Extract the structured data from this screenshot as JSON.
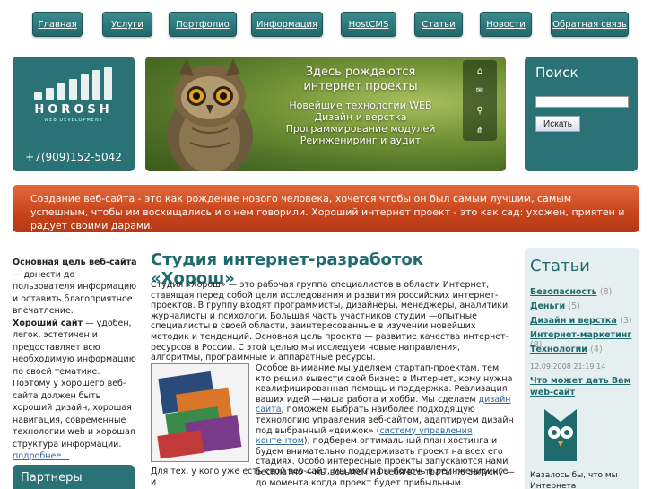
{
  "nav": {
    "items": [
      {
        "label": "Главная"
      },
      {
        "label": "Услуги"
      },
      {
        "label": "Портфолио"
      },
      {
        "label": "Информация"
      },
      {
        "label": "HostCMS"
      },
      {
        "label": "Статьи"
      },
      {
        "label": "Новости"
      },
      {
        "label": "Обратная связь"
      }
    ]
  },
  "logo": {
    "name": "HOROSH",
    "tagline": "WEB DEVELOPMENT",
    "phone": "+7(909)152-5042"
  },
  "hero": {
    "title_line1": "Здесь рождаются",
    "title_line2": "интернет проекты",
    "lines": [
      "Новейшие технологии WEB",
      "Дизайн и верстка",
      "Программирование модулей",
      "Реинжениринг и аудит"
    ],
    "icons": [
      "home-icon",
      "mail-icon",
      "search-icon",
      "sitemap-icon"
    ]
  },
  "search": {
    "title": "Поиск",
    "placeholder": "",
    "button_label": "Искать"
  },
  "banner": {
    "text": "Создание веб-сайта - это как рождение нового человека, хочется чтобы он был самым лучшим, самым успешным, чтобы им восхищались и о нем говорили. Хороший интернет проект - это как сад: ухожен, приятен и радует своими дарами."
  },
  "left": {
    "bold1": "Основная цель веб-сайта",
    "text1": " — донести до пользователя информацию и оставить благоприятное впечатление.",
    "bold2": "Хороший сайт",
    "text2": " — удобен, легок, эстетичен и предоставляет всю необходимую информацию по своей тематике. Поэтому у хорошего веб-сайта должен быть хороший дизайн, хорошая навигация, современные технологии web и хорошая структура информации.",
    "more": "подробнее...",
    "partners_title": "Партнеры"
  },
  "main": {
    "title": "Студия интернет-разработок «Хорош»",
    "p1": "Студия «Хорош» — это рабочая группа специалистов в области Интернет, ставящая перед собой цели исследования и развития российских интернет-проектов. В группу входят программисты, дизайнеры, менеджеры, аналитики, журналисты и психологи. Большая часть участников студии —опытные специалисты в своей области, заинтересованные в изучении новейших методик и тенденций. Основная цель проекта — развитие качества интернет-ресурсов в России. С этой целью мы исследуем новые направления, алгоритмы, программные и аппаратные ресурсы.",
    "p2_a": "Особое внимание мы уделяем стартап-проектам, тем, кто решил вывести свой бизнес в Интернет, кому нужна квалифицированная помощь и поддержка. Реализация ваших идей —наша работа и хобби. Мы сделаем ",
    "p2_link1": "дизайн сайта",
    "p2_b": ", поможем выбрать наиболее подходящую технологию управления веб-сайтом, адаптируем дизайн под выбранный «движок» (",
    "p2_link2": "систему управления контентом",
    "p2_c": "), подберем оптимальный план хостинга и будем внимательно поддерживать проект на всех его стадиях. Особо интересные проекты запускаются нами бесплатно —мы возьмем на себя все траты по запуску — до момента когда проект будет прибыльным.",
    "p3": "Для тех, у кого уже есть свой веб-сайт, мы могли бы помочь в реинжениринге и"
  },
  "articles": {
    "title": "Статьи",
    "categories": [
      {
        "name": "Безопасность",
        "count": "(8)"
      },
      {
        "name": "Деньги",
        "count": "(5)"
      },
      {
        "name": "Дизайн и верстка",
        "count": "(3)"
      },
      {
        "name": "Интернет-маркетинг",
        "count": "(8)"
      },
      {
        "name": "Технологии",
        "count": "(4)"
      }
    ],
    "date": "12.09.2008 21:19:14",
    "link": "Что может дать Вам web-сайт",
    "bottom_text": "Казалось бы, что мы Интернета"
  }
}
